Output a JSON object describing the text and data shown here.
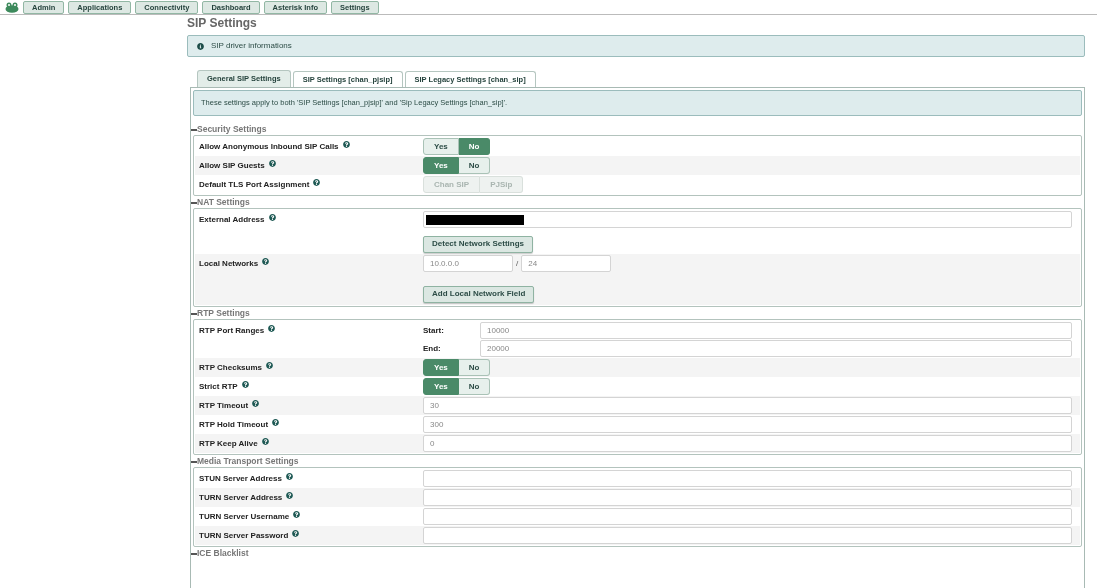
{
  "nav": [
    {
      "label": "Admin"
    },
    {
      "label": "Applications"
    },
    {
      "label": "Connectivity"
    },
    {
      "label": "Dashboard"
    },
    {
      "label": "Asterisk Info"
    },
    {
      "label": "Settings"
    }
  ],
  "page_title": "SIP Settings",
  "info_box": "SIP driver informations",
  "tabs": [
    {
      "label": "General SIP Settings",
      "selected": true
    },
    {
      "label": "SIP Settings [chan_pjsip]",
      "selected": false
    },
    {
      "label": "SIP Legacy Settings [chan_sip]",
      "selected": false
    }
  ],
  "note": "These settings apply to both 'SIP Settings [chan_pjsip]' and 'Sip Legacy Settings [chan_sip]'.",
  "sections": [
    {
      "title": "Security Settings",
      "rows": [
        {
          "kind": "toggle",
          "label": "Allow Anonymous Inbound SIP Calls",
          "disabled": false,
          "options": [
            {
              "label": "Yes",
              "selected": false
            },
            {
              "label": "No",
              "selected": true
            }
          ]
        },
        {
          "kind": "toggle",
          "label": "Allow SIP Guests",
          "disabled": false,
          "options": [
            {
              "label": "Yes",
              "selected": true
            },
            {
              "label": "No",
              "selected": false
            }
          ]
        },
        {
          "kind": "toggle",
          "label": "Default TLS Port Assignment",
          "disabled": true,
          "options": [
            {
              "label": "Chan SIP",
              "selected": false
            },
            {
              "label": "PJSip",
              "selected": false
            }
          ]
        }
      ]
    },
    {
      "title": "NAT Settings",
      "rows": [
        {
          "kind": "redacted",
          "label": "External Address",
          "button": "Detect Network Settings"
        },
        {
          "kind": "network",
          "label": "Local Networks",
          "address": "10.0.0.0",
          "separator": "/",
          "mask": "24",
          "button": "Add Local Network Field"
        }
      ]
    },
    {
      "title": "RTP Settings",
      "rows": [
        {
          "kind": "range",
          "label": "RTP Port Ranges",
          "start_label": "Start:",
          "start": "10000",
          "end_label": "End:",
          "end": "20000"
        },
        {
          "kind": "toggle",
          "label": "RTP Checksums",
          "disabled": false,
          "options": [
            {
              "label": "Yes",
              "selected": true
            },
            {
              "label": "No",
              "selected": false
            }
          ]
        },
        {
          "kind": "toggle",
          "label": "Strict RTP",
          "disabled": false,
          "options": [
            {
              "label": "Yes",
              "selected": true
            },
            {
              "label": "No",
              "selected": false
            }
          ]
        },
        {
          "kind": "input",
          "label": "RTP Timeout",
          "value": "30"
        },
        {
          "kind": "input",
          "label": "RTP Hold Timeout",
          "value": "300"
        },
        {
          "kind": "input",
          "label": "RTP Keep Alive",
          "value": "0"
        }
      ]
    },
    {
      "title": "Media Transport Settings",
      "rows": [
        {
          "kind": "input",
          "label": "STUN Server Address"
        },
        {
          "kind": "input",
          "label": "TURN Server Address"
        },
        {
          "kind": "input",
          "label": "TURN Server Username"
        },
        {
          "kind": "input",
          "label": "TURN Server Password"
        }
      ]
    },
    {
      "title": "ICE Blacklist"
    }
  ]
}
